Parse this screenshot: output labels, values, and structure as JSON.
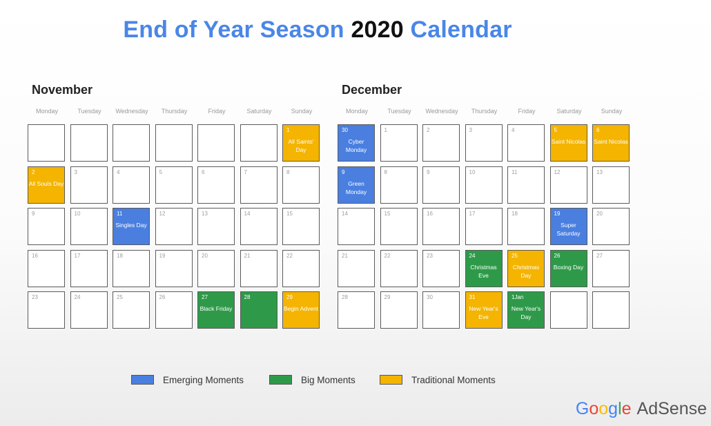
{
  "title": {
    "part1": "End of Year Season",
    "part2": "2020",
    "part3": "Calendar"
  },
  "weekdays": [
    "Monday",
    "Tuesday",
    "Wednesday",
    "Thursday",
    "Friday",
    "Saturday",
    "Sunday"
  ],
  "months": [
    {
      "name": "November",
      "rows": [
        [
          {
            "n": ""
          },
          {
            "n": ""
          },
          {
            "n": ""
          },
          {
            "n": ""
          },
          {
            "n": ""
          },
          {
            "n": ""
          },
          {
            "n": "1",
            "label": "All Saints' Day",
            "type": "traditional"
          }
        ],
        [
          {
            "n": "2",
            "label": "All Souls Day",
            "type": "traditional"
          },
          {
            "n": "3"
          },
          {
            "n": "4"
          },
          {
            "n": "5"
          },
          {
            "n": "6"
          },
          {
            "n": "7"
          },
          {
            "n": "8"
          }
        ],
        [
          {
            "n": "9"
          },
          {
            "n": "10"
          },
          {
            "n": "11",
            "label": "Singles Day",
            "type": "emerging"
          },
          {
            "n": "12"
          },
          {
            "n": "13"
          },
          {
            "n": "14"
          },
          {
            "n": "15"
          }
        ],
        [
          {
            "n": "16"
          },
          {
            "n": "17"
          },
          {
            "n": "18"
          },
          {
            "n": "19"
          },
          {
            "n": "20"
          },
          {
            "n": "21"
          },
          {
            "n": "22"
          }
        ],
        [
          {
            "n": "23"
          },
          {
            "n": "24"
          },
          {
            "n": "25"
          },
          {
            "n": "26"
          },
          {
            "n": "27",
            "label": "Black Friday",
            "type": "big"
          },
          {
            "n": "28",
            "type": "big"
          },
          {
            "n": "29",
            "label": "Begin Advent",
            "type": "traditional"
          }
        ]
      ]
    },
    {
      "name": "December",
      "rows": [
        [
          {
            "n": "30",
            "label": "Cyber Monday",
            "type": "emerging"
          },
          {
            "n": "1"
          },
          {
            "n": "2"
          },
          {
            "n": "3"
          },
          {
            "n": "4"
          },
          {
            "n": "5",
            "label": "Saint Nicolas",
            "type": "traditional"
          },
          {
            "n": "6",
            "label": "Saint Nicolas",
            "type": "traditional"
          }
        ],
        [
          {
            "n": "9",
            "label": "Green Monday",
            "type": "emerging"
          },
          {
            "n": "8"
          },
          {
            "n": "9"
          },
          {
            "n": "10"
          },
          {
            "n": "11"
          },
          {
            "n": "12"
          },
          {
            "n": "13"
          }
        ],
        [
          {
            "n": "14"
          },
          {
            "n": "15"
          },
          {
            "n": "16"
          },
          {
            "n": "17"
          },
          {
            "n": "18"
          },
          {
            "n": "19",
            "label": "Super Saturday",
            "type": "emerging"
          },
          {
            "n": "20"
          }
        ],
        [
          {
            "n": "21"
          },
          {
            "n": "22"
          },
          {
            "n": "23"
          },
          {
            "n": "24",
            "label": "Christmas Eve",
            "type": "big"
          },
          {
            "n": "25",
            "label": "Christmas Day",
            "type": "traditional"
          },
          {
            "n": "26",
            "label": "Boxing Day",
            "type": "big"
          },
          {
            "n": "27"
          }
        ],
        [
          {
            "n": "28"
          },
          {
            "n": "29"
          },
          {
            "n": "30"
          },
          {
            "n": "31",
            "label": "New Year's Eve",
            "type": "traditional"
          },
          {
            "n": "1Jan",
            "label": "New Year's Day",
            "type": "big"
          },
          {
            "n": ""
          },
          {
            "n": ""
          }
        ]
      ]
    }
  ],
  "legend": [
    {
      "label": "Emerging Moments",
      "color": "#4a7fe0"
    },
    {
      "label": "Big Moments",
      "color": "#2e9a49"
    },
    {
      "label": "Traditional Moments",
      "color": "#f4b400"
    }
  ],
  "brand": {
    "google": "Google",
    "product": "AdSense"
  },
  "colors": {
    "emerging": "#4a7fe0",
    "big": "#2e9a49",
    "traditional": "#f4b400",
    "title_blue": "#4a86e8"
  }
}
